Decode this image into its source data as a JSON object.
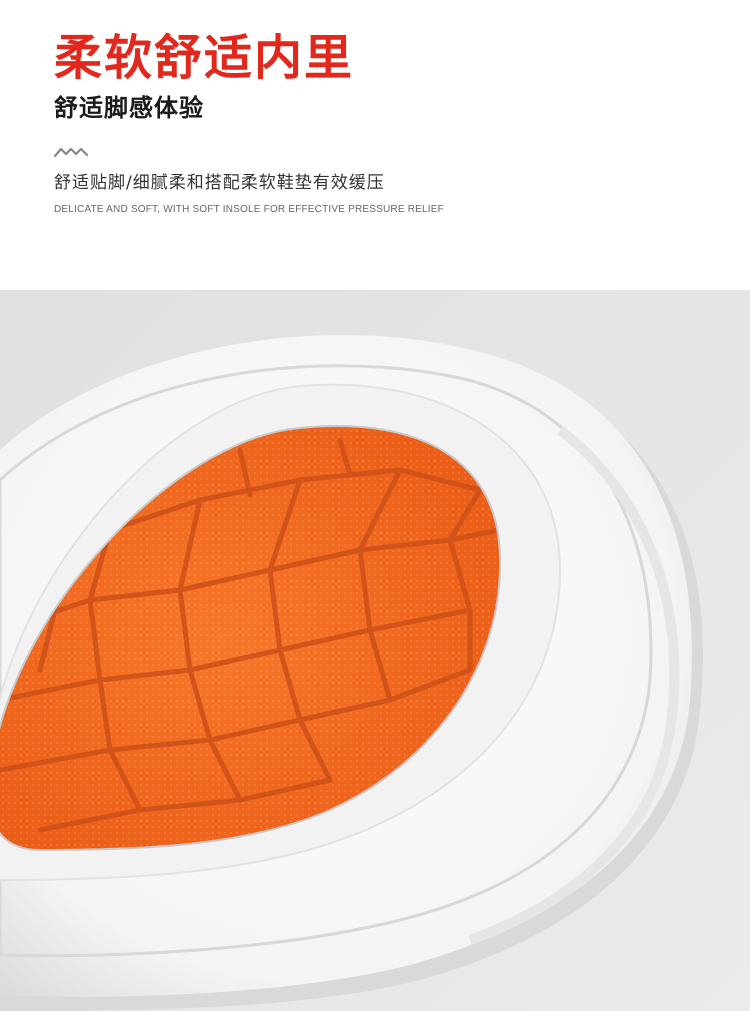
{
  "header": {
    "title": "柔软舒适内里",
    "subtitle": "舒适脚感体验",
    "description_cn": "舒适贴脚/细腻柔和搭配柔软鞋垫有效缓压",
    "description_en": "DELICATE AND SOFT, WITH SOFT INSOLE FOR EFFECTIVE PRESSURE RELIEF",
    "decor_icon": "zigzag-icon"
  },
  "photo": {
    "subject": "slipper-insole-closeup",
    "colors": {
      "background": "#e3e3e3",
      "shell": "#f7f7f7",
      "insole": "#f26a1f",
      "insole_groove": "#d2531a"
    }
  },
  "colors": {
    "accent": "#e0281c",
    "text_dark": "#1a1a1a"
  }
}
